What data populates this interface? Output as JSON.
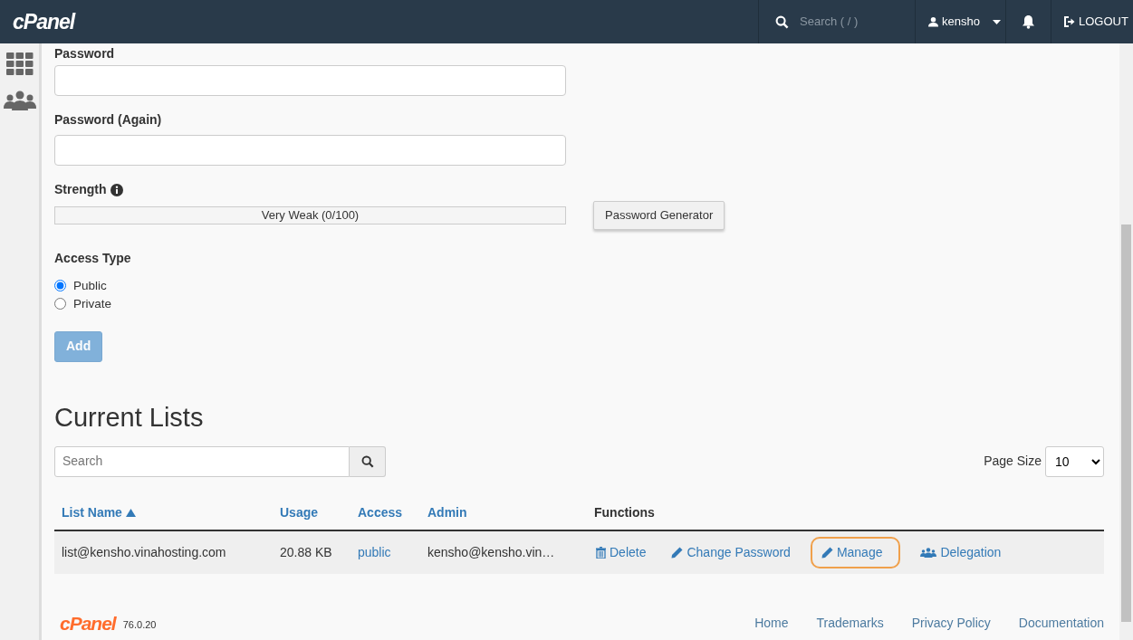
{
  "navbar": {
    "brand": "cPanel",
    "search": {
      "placeholder": "Search ( / )"
    },
    "user": "kensho",
    "logout": "LOGOUT"
  },
  "sidebar": {
    "items": [
      {
        "kind": "grid",
        "selected": false
      },
      {
        "kind": "users",
        "selected": false
      }
    ]
  },
  "form": {
    "password": {
      "label": "Password"
    },
    "password_again": {
      "label": "Password (Again)"
    },
    "strength": {
      "label": "Strength",
      "level": 0,
      "reading": "Very Weak (0/100)"
    },
    "generator_button": "Password Generator",
    "access_type": {
      "label": "Access Type",
      "options": [
        {
          "label": "Public",
          "selected": true
        },
        {
          "label": "Private",
          "selected": false
        }
      ]
    },
    "submit": {
      "label": "Add",
      "disabled": true
    }
  },
  "current_lists": {
    "title": "Current Lists",
    "search": {
      "placeholder": "Search"
    },
    "page_size": {
      "label": "Page Size",
      "value": "10"
    },
    "table": {
      "columns": [
        {
          "label": "List Name",
          "sortable": true,
          "sorted": true
        },
        {
          "label": "Usage",
          "sortable": true,
          "sorted": false
        },
        {
          "label": "Access",
          "sortable": true,
          "sorted": false
        },
        {
          "label": "Admin",
          "sortable": true,
          "sorted": false
        },
        {
          "label": "Functions",
          "sortable": false,
          "sorted": false
        }
      ],
      "rows": [
        {
          "list_name": "list@kensho.vinahosting.com",
          "usage": "20.88 KB",
          "access": "public",
          "admin": "kensho@kensho.vin…",
          "actions": [
            {
              "kind": "delete",
              "label": "Delete",
              "highlighted": false
            },
            {
              "kind": "change_password",
              "label": "Change Password",
              "highlighted": false
            },
            {
              "kind": "manage",
              "label": "Manage",
              "highlighted": true
            },
            {
              "kind": "delegation",
              "label": "Delegation",
              "highlighted": false
            }
          ]
        }
      ]
    }
  },
  "footer": {
    "brand": "cPanel",
    "version": "76.0.20",
    "links": [
      "Home",
      "Trademarks",
      "Privacy Policy",
      "Documentation"
    ]
  }
}
